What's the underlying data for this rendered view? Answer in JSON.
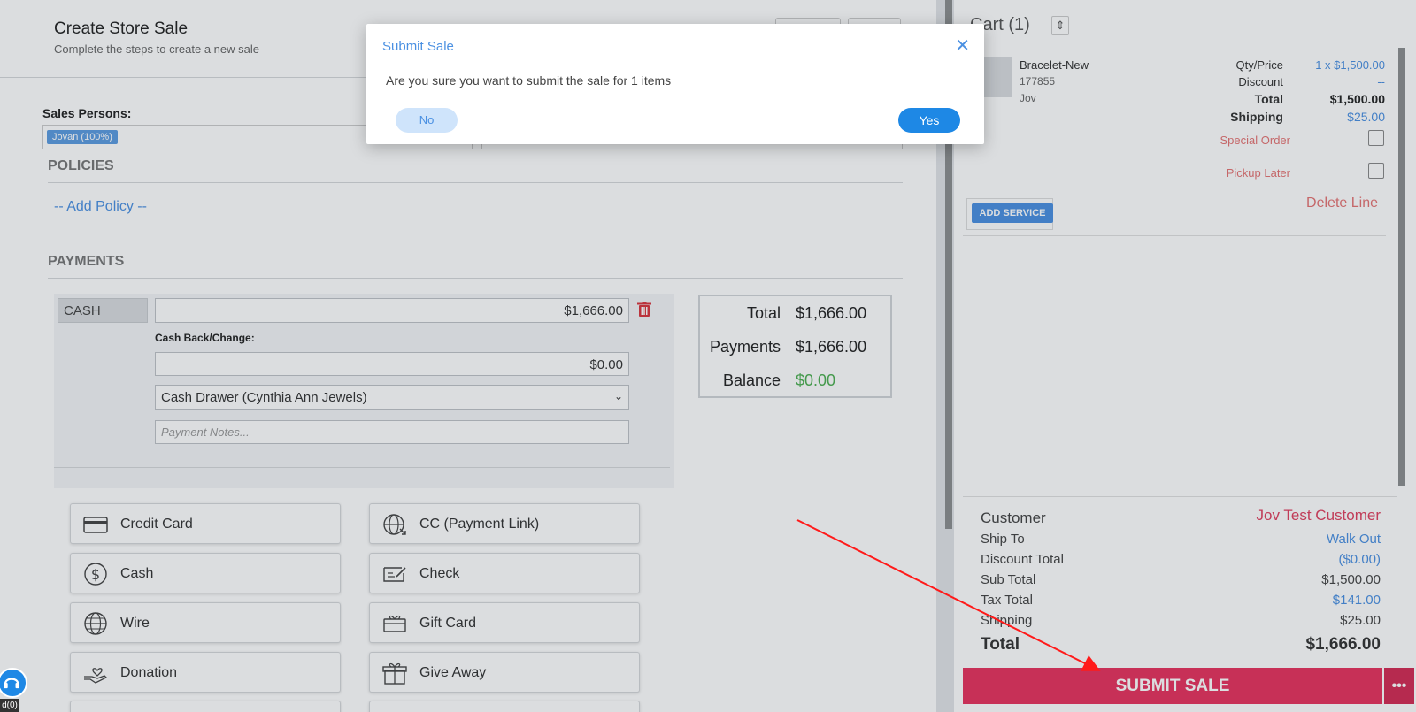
{
  "header": {
    "title": "Create Store Sale",
    "subtitle": "Complete the steps to create a new sale"
  },
  "sales_persons": {
    "label": "Sales Persons:",
    "tag": "Jovan (100%)"
  },
  "policies": {
    "heading": "POLICIES",
    "add_label": "-- Add Policy --"
  },
  "payments": {
    "heading": "PAYMENTS",
    "type": "CASH",
    "amount": "$1,666.00",
    "cash_back_label": "Cash Back/Change:",
    "cash_back_value": "$0.00",
    "drawer": "Cash Drawer (Cynthia Ann Jewels)",
    "notes_placeholder": "Payment Notes...",
    "totals": {
      "total_label": "Total",
      "total_value": "$1,666.00",
      "payments_label": "Payments",
      "payments_value": "$1,666.00",
      "balance_label": "Balance",
      "balance_value": "$0.00"
    },
    "methods": [
      {
        "label": "Credit Card",
        "icon": "credit-card-icon"
      },
      {
        "label": "CC (Payment Link)",
        "icon": "globe-link-icon"
      },
      {
        "label": "Cash",
        "icon": "dollar-circle-icon"
      },
      {
        "label": "Check",
        "icon": "check-icon"
      },
      {
        "label": "Wire",
        "icon": "globe-icon"
      },
      {
        "label": "Gift Card",
        "icon": "gift-card-icon"
      },
      {
        "label": "Donation",
        "icon": "hand-heart-icon"
      },
      {
        "label": "Give Away",
        "icon": "gift-box-icon"
      }
    ]
  },
  "cart": {
    "title": "Cart (1)",
    "item": {
      "name": "Bracelet-New",
      "sku": "177855",
      "owner": "Jov",
      "qty_price_label": "Qty/Price",
      "qty_price_value": "1 x $1,500.00",
      "discount_label": "Discount",
      "discount_value": "--",
      "total_label": "Total",
      "total_value": "$1,500.00",
      "shipping_label": "Shipping",
      "shipping_value": "$25.00",
      "special_order_label": "Special Order",
      "pickup_later_label": "Pickup Later",
      "add_service_label": "ADD SERVICE",
      "delete_line_label": "Delete Line"
    },
    "summary": {
      "customer_label": "Customer",
      "customer_value": "Jov Test Customer",
      "ship_to_label": "Ship To",
      "ship_to_value": "Walk Out",
      "discount_total_label": "Discount Total",
      "discount_total_value": "($0.00)",
      "sub_total_label": "Sub Total",
      "sub_total_value": "$1,500.00",
      "tax_total_label": "Tax Total",
      "tax_total_value": "$141.00",
      "shipping_label": "Shipping",
      "shipping_value": "$25.00",
      "total_label": "Total",
      "total_value": "$1,666.00"
    },
    "submit_label": "SUBMIT SALE",
    "more_label": "•••"
  },
  "dialog": {
    "title": "Submit Sale",
    "close_glyph": "✕",
    "message": "Are you sure you want to submit the sale for 1 items",
    "no_label": "No",
    "yes_label": "Yes"
  },
  "help": {
    "badge": "d(0)"
  },
  "colors": {
    "accent": "#4a90e2",
    "submit": "#e8325e",
    "balance_green": "#4caf50",
    "annotation_arrow": "#ff1a1a"
  }
}
